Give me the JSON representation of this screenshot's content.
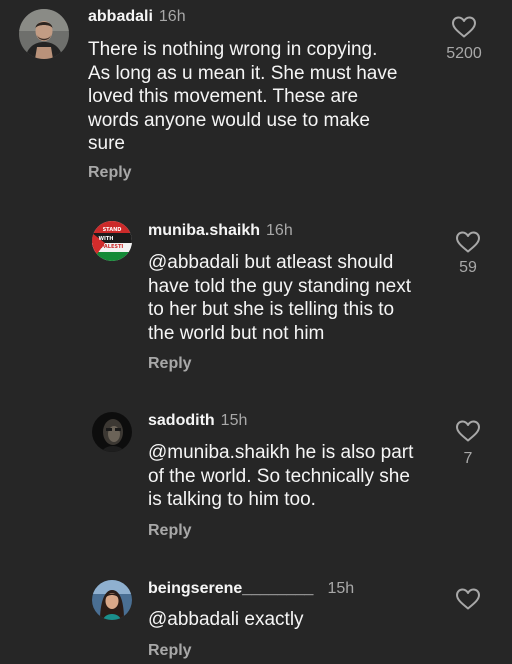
{
  "colors": {
    "background": "#262626",
    "text": "#f5f5f5",
    "muted": "#a8a8a8"
  },
  "comments": [
    {
      "username": "abbadali",
      "time": "16h",
      "lines": [
        "There is nothing wrong in copying.",
        "As long as u mean it. She must have",
        "loved this movement. These are",
        "words anyone would use to make",
        "sure"
      ],
      "reply_label": "Reply",
      "likes": "5200",
      "like_icon": "heart-outline-icon"
    },
    {
      "username": "muniba.shaikh",
      "time": "16h",
      "avatar_text": [
        "STAND",
        "WITH",
        "PALESTI"
      ],
      "lines": [
        "@abbadali but atleast should",
        "have told the guy standing next",
        "to her but she is telling this to",
        "the world but not him"
      ],
      "reply_label": "Reply",
      "likes": "59",
      "like_icon": "heart-outline-icon"
    },
    {
      "username": "sadodith",
      "time": "15h",
      "lines": [
        "@muniba.shaikh he is also part",
        "of the world. So technically she",
        "is talking to him too."
      ],
      "reply_label": "Reply",
      "likes": "7",
      "like_icon": "heart-outline-icon"
    },
    {
      "username": "beingserene________",
      "time": "15h",
      "lines": [
        "@abbadali exactly"
      ],
      "reply_label": "Reply",
      "likes": "",
      "like_icon": "heart-outline-icon"
    }
  ]
}
